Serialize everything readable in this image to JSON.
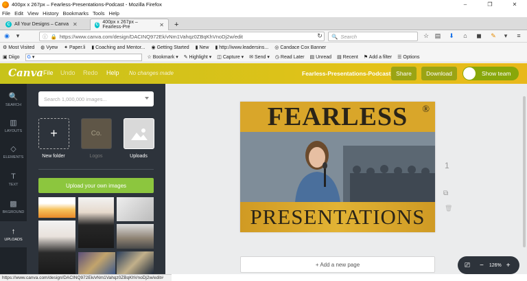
{
  "window": {
    "title": "400px x 267px – Fearless-Presentations-Podcast - Mozilla Firefox",
    "minimize": "–",
    "maximize": "❐",
    "close": "✕"
  },
  "menubar": [
    "File",
    "Edit",
    "View",
    "History",
    "Bookmarks",
    "Tools",
    "Help"
  ],
  "tabs": [
    {
      "label": "All Your Designs – Canva",
      "icon": "C"
    },
    {
      "label": "400px x 267px – Fearless-Pre",
      "icon": "C"
    }
  ],
  "new_tab": "+",
  "nav": {
    "url": "https://www.canva.com/design/DACINQ972Ek/vNm1Vahqz0ZBqKhVnoDj2w/edit",
    "search_placeholder": "Search"
  },
  "bookmarks": [
    "Most Visited",
    "Vyew",
    "Paper.li",
    "Coaching and Mentor...",
    "Getting Started",
    "New",
    "http://www.leadersins...",
    "Candace Cox Banner"
  ],
  "diigo_bar": {
    "brand": "Diigo",
    "search_value": "G",
    "items": [
      "Bookmark",
      "Highlight",
      "Capture",
      "Send",
      "Read Later",
      "Unread",
      "Recent",
      "Add a filter",
      "Options"
    ]
  },
  "canva_header": {
    "logo": "Canva",
    "menu": [
      "File",
      "Undo",
      "Redo",
      "Help"
    ],
    "status": "No changes made",
    "doc_name": "Fearless-Presentations-Podcast",
    "share": "Share",
    "download": "Download",
    "show_team": "Show team"
  },
  "rail": [
    "SEARCH",
    "LAYOUTS",
    "ELEMENTS",
    "TEXT",
    "BKGROUND",
    "UPLOADS"
  ],
  "panel": {
    "search_placeholder": "Search 1,000,000 images...",
    "folders": [
      "New folder",
      "Logos",
      "Uploads"
    ],
    "logo_folder_text": "Co.",
    "upload_button": "Upload your own images"
  },
  "design": {
    "top_text": "FEARLESS",
    "registered": "®",
    "bottom_text": "PRESENTATIONS"
  },
  "page_number": "1",
  "add_page": "+ Add a new page",
  "zoom": "126%",
  "status_url": "https://www.canva.com/design/DACINQ972Ek/vNm1Vahqz0ZBqKhVnoDj2w/edit#"
}
